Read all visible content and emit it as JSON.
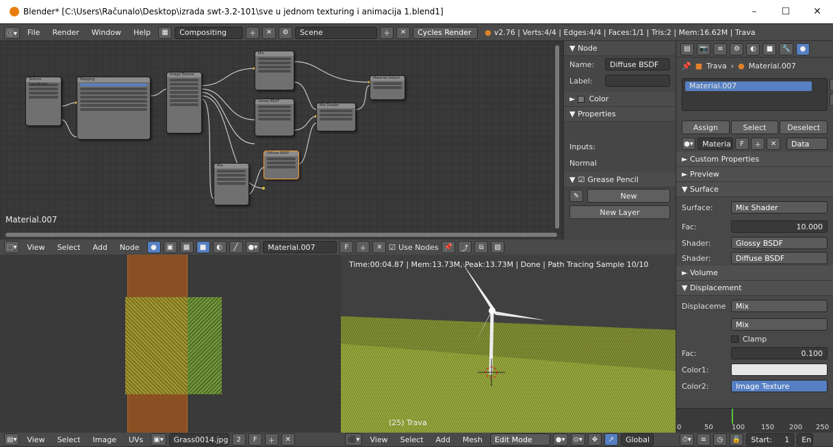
{
  "window": {
    "title": "Blender* [C:\\Users\\Računalo\\Desktop\\izrada swt-3.2-101\\sve u jednom texturing i animacija 1.blend1]",
    "minimize": "–",
    "maximize": "☐",
    "close": "✕"
  },
  "info_header": {
    "menus": [
      "File",
      "Render",
      "Window",
      "Help"
    ],
    "layout": "Compositing",
    "scene": "Scene",
    "engine": "Cycles Render",
    "stats": "v2.76 | Verts:4/4 | Edges:4/4 | Faces:1/1 | Tris:2 | Mem:16.62M | Trava"
  },
  "node_editor": {
    "material_label": "Material.007",
    "header": {
      "menus": [
        "View",
        "Select",
        "Add",
        "Node"
      ],
      "material": "Material.007",
      "fake_user": "F",
      "use_nodes": "Use Nodes"
    }
  },
  "node_panel": {
    "node_section": "▼ Node",
    "name_label": "Name:",
    "name_value": "Diffuse BSDF",
    "label_label": "Label:",
    "color_section": "Color",
    "properties_section": "▼ Properties",
    "inputs_label": "Inputs:",
    "normal_label": "Normal",
    "grease_pencil_section": "Grease Pencil",
    "new_button": "New",
    "new_layer_button": "New Layer"
  },
  "properties": {
    "breadcrumb": [
      "Trava",
      "Material.007"
    ],
    "material_slot": "Material.007",
    "assign": "Assign",
    "select": "Select",
    "deselect": "Deselect",
    "material_field": "Materia",
    "fake_user": "F",
    "data_dropdown": "Data",
    "custom_properties": "► Custom Properties",
    "preview": "► Preview",
    "surface_section": "▼ Surface",
    "surface_label": "Surface:",
    "surface_value": "Mix Shader",
    "fac_label": "Fac:",
    "fac_value": "10.000",
    "shader1_label": "Shader:",
    "shader1_value": "Glossy BSDF",
    "shader2_label": "Shader:",
    "shader2_value": "Diffuse BSDF",
    "volume_section": "► Volume",
    "displacement_section": "▼ Displacement",
    "displace_label": "Displaceme",
    "displace_value": "Mix",
    "mix_dropdown": "Mix",
    "clamp_label": "Clamp",
    "fac2_label": "Fac:",
    "fac2_value": "0.100",
    "color1_label": "Color1:",
    "color2_label": "Color2:",
    "color2_value": "Image Texture"
  },
  "image_editor": {
    "header": {
      "menus": [
        "View",
        "Select",
        "Image",
        "UVs"
      ],
      "image": "Grass0014.jpg",
      "users": "2",
      "fake_user": "F"
    }
  },
  "viewport": {
    "info": "Time:00:04.87 | Mem:13.73M, Peak:13.73M | Done | Path Tracing Sample 10/10",
    "object_label": "(25) Trava",
    "header": {
      "menus": [
        "View",
        "Select",
        "Add",
        "Mesh"
      ],
      "mode": "Edit Mode",
      "orientation": "Global"
    }
  },
  "timeline": {
    "ticks": [
      "0",
      "50",
      "100",
      "150",
      "200",
      "250"
    ],
    "start_label": "Start:",
    "start_value": "1",
    "end_label": "En"
  },
  "colors": {
    "accent": "#5680c2",
    "selected_node": "#ffa033",
    "background": "#3d3d3d"
  }
}
